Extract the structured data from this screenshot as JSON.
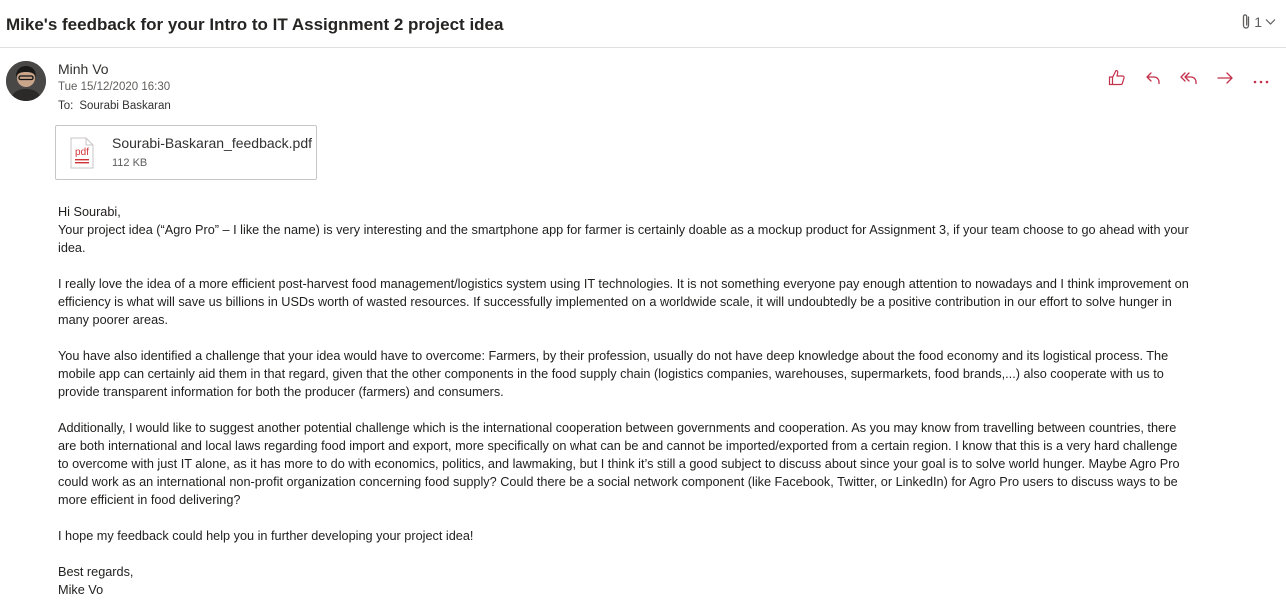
{
  "email": {
    "subject": "Mike's feedback for your Intro to IT Assignment 2 project idea",
    "attachment_count": "1",
    "sender": "Minh Vo",
    "date": "Tue 15/12/2020 16:30",
    "to_label": "To:",
    "to": "Sourabi Baskaran"
  },
  "attachment": {
    "icon_label": "pdf",
    "name": "Sourabi-Baskaran_feedback.pdf",
    "size": "112 KB"
  },
  "icons": {
    "like": "thumbs-up-icon",
    "reply": "reply-icon",
    "reply_all": "reply-all-icon",
    "forward": "forward-icon",
    "more": "more-icon",
    "accent": "#c4314b"
  },
  "body": {
    "greeting": "Hi Sourabi,",
    "p1": [
      "Your project idea (“Agro Pro” – I like the name) is very interesting and the smartphone app for farmer is certainly doable as a mockup product for Assignment 3, if your team choose to go ahead with your",
      "idea."
    ],
    "p2": [
      "I really love the idea of a more efficient post-harvest food management/logistics system using IT technologies. It is not something everyone pay enough attention to nowadays and I think improvement on",
      "efficiency is what will save us billions in USDs worth of wasted resources. If successfully implemented on a worldwide scale, it will undoubtedly be a positive contribution in our effort to solve hunger in",
      "many poorer areas."
    ],
    "p3": [
      "You have also identified a challenge that your idea would have to overcome: Farmers, by their profession, usually do not have deep knowledge about the food economy and its logistical process. The",
      "mobile app can certainly aid them in that regard, given that the other components in the food supply chain (logistics companies, warehouses, supermarkets, food brands,...) also cooperate with us to",
      "provide transparent information for both the producer (farmers) and consumers."
    ],
    "p4": [
      "Additionally, I would like to suggest another potential challenge which is the international cooperation between governments and cooperation. As you may know from travelling between countries, there",
      "are both international and local laws regarding food import and export, more specifically on what can be and cannot be imported/exported from a certain region. I know that this is a very hard challenge",
      "to overcome with just IT alone, as it has more to do with economics, politics, and lawmaking, but I think it’s still a good subject to discuss about since your goal is to solve world hunger. Maybe Agro Pro",
      "could work as an international non-profit organization concerning food supply? Could there be a social network component (like Facebook, Twitter, or LinkedIn) for Agro Pro users to discuss ways to be",
      "more efficient in food delivering?"
    ],
    "p5": "I hope my feedback could help you in further developing your project idea!",
    "closing": "Best regards,",
    "signature": "Mike Vo"
  }
}
